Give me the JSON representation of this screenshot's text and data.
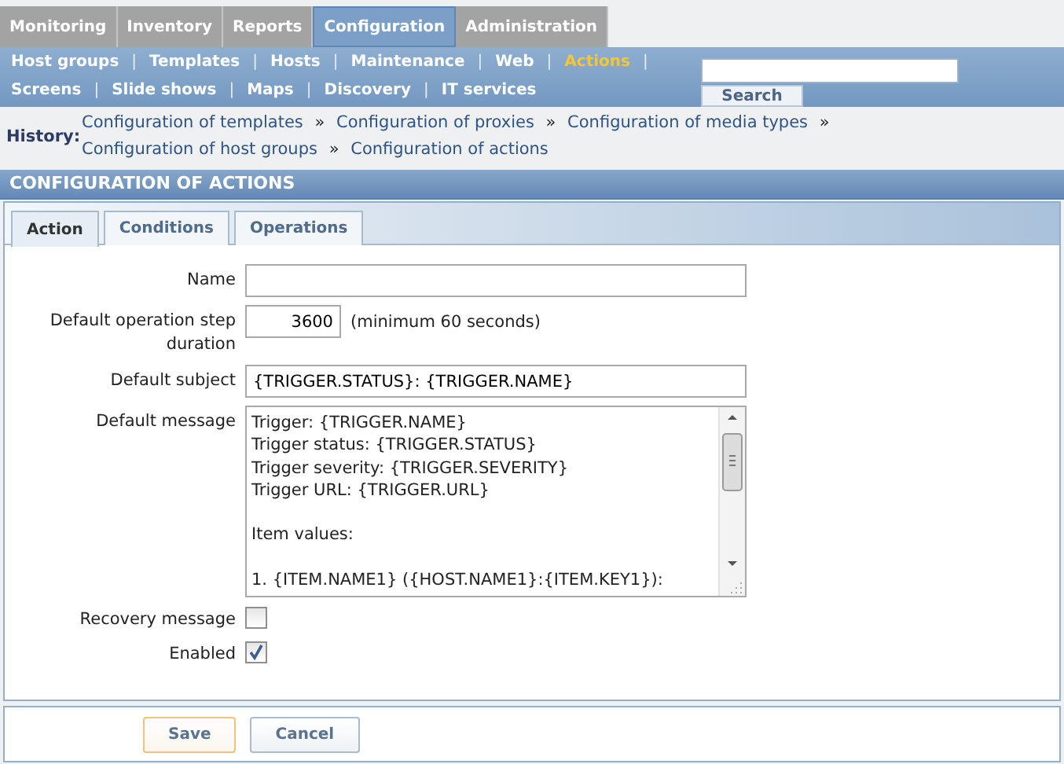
{
  "main_menu": [
    {
      "label": "Monitoring",
      "selected": false
    },
    {
      "label": "Inventory",
      "selected": false
    },
    {
      "label": "Reports",
      "selected": false
    },
    {
      "label": "Configuration",
      "selected": true
    },
    {
      "label": "Administration",
      "selected": false
    }
  ],
  "sub_menu": {
    "separator": "|",
    "rows": [
      [
        {
          "label": "Host groups",
          "selected": false
        },
        {
          "label": "Templates",
          "selected": false
        },
        {
          "label": "Hosts",
          "selected": false
        },
        {
          "label": "Maintenance",
          "selected": false
        },
        {
          "label": "Web",
          "selected": false
        },
        {
          "label": "Actions",
          "selected": true
        }
      ],
      [
        {
          "label": "Screens",
          "selected": false
        },
        {
          "label": "Slide shows",
          "selected": false
        },
        {
          "label": "Maps",
          "selected": false
        },
        {
          "label": "Discovery",
          "selected": false
        },
        {
          "label": "IT services",
          "selected": false
        }
      ]
    ]
  },
  "search": {
    "button": "Search"
  },
  "history": {
    "label": "History:",
    "separator": "»",
    "links": [
      "Configuration of templates",
      "Configuration of proxies",
      "Configuration of media types",
      "Configuration of host groups",
      "Configuration of actions"
    ]
  },
  "section_title": "CONFIGURATION OF ACTIONS",
  "form": {
    "tabs": [
      {
        "label": "Action",
        "selected": true
      },
      {
        "label": "Conditions",
        "selected": false
      },
      {
        "label": "Operations",
        "selected": false
      }
    ],
    "fields": [
      {
        "kind": "text",
        "label": "Name"
      },
      {
        "kind": "number",
        "label": "Default operation step duration",
        "value": "3600",
        "hint": "(minimum 60 seconds)"
      },
      {
        "kind": "text",
        "label": "Default subject",
        "value": "{TRIGGER.STATUS}: {TRIGGER.NAME}"
      },
      {
        "kind": "textarea",
        "label": "Default message",
        "value": "Trigger: {TRIGGER.NAME}\nTrigger status: {TRIGGER.STATUS}\nTrigger severity: {TRIGGER.SEVERITY}\nTrigger URL: {TRIGGER.URL}\n\nItem values:\n\n1. {ITEM.NAME1} ({HOST.NAME1}:{ITEM.KEY1}):"
      },
      {
        "kind": "checkbox",
        "label": "Recovery message",
        "checked": false
      },
      {
        "kind": "checkbox",
        "label": "Enabled",
        "checked": true
      }
    ]
  },
  "buttons": [
    {
      "label": "Save",
      "kind": "primary"
    },
    {
      "label": "Cancel",
      "kind": "secondary"
    }
  ]
}
